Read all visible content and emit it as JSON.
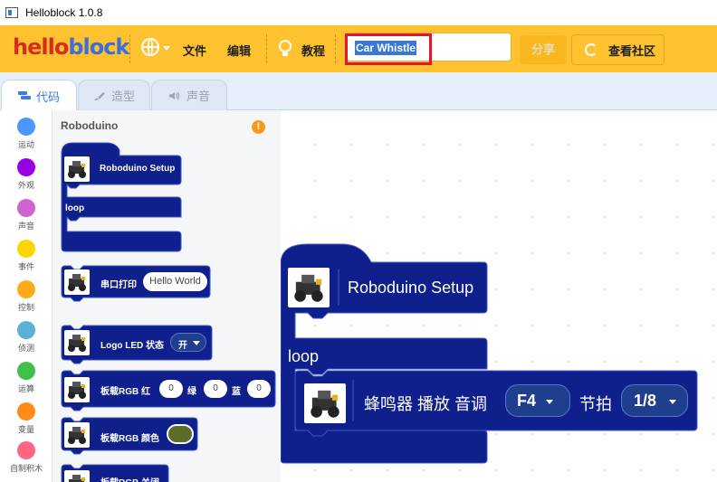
{
  "window": {
    "title": "Helloblock 1.0.8"
  },
  "menubar": {
    "logo_part1": "hello",
    "logo_part2": "block",
    "language_icon": "globe-icon",
    "file_label": "文件",
    "edit_label": "编辑",
    "tutorial_icon": "lightbulb-icon",
    "tutorial_label": "教程",
    "project_title": "Car Whistle",
    "share_label": "分享",
    "community_icon": "refresh-icon",
    "community_label": "查看社区"
  },
  "tabs": [
    {
      "label": "代码",
      "icon": "code-icon",
      "active": true
    },
    {
      "label": "造型",
      "icon": "brush-icon",
      "active": false
    },
    {
      "label": "声音",
      "icon": "speaker-icon",
      "active": false
    }
  ],
  "categories": [
    {
      "label": "运动",
      "color": "#4c97ff"
    },
    {
      "label": "外观",
      "color": "#9a00e6"
    },
    {
      "label": "声音",
      "color": "#cf63cf"
    },
    {
      "label": "事件",
      "color": "#ffd500"
    },
    {
      "label": "控制",
      "color": "#ffab19"
    },
    {
      "label": "侦测",
      "color": "#5cb1d6"
    },
    {
      "label": "运算",
      "color": "#40bf4a"
    },
    {
      "label": "变量",
      "color": "#ff8c1a"
    },
    {
      "label": "自制积木",
      "color": "#ff6680"
    }
  ],
  "flyout": {
    "title": "Roboduino",
    "warning_icon": "info-icon",
    "setup_label": "Roboduino Setup",
    "loop_label": "loop",
    "serial_print_label": "串口打印",
    "serial_print_value": "Hello World",
    "logo_led_label": "Logo LED 状态",
    "logo_led_value": "开",
    "rgb_label": "板载RGB 红",
    "rgb_red": "0",
    "rgb_green_label": "绿",
    "rgb_green": "0",
    "rgb_blue_label": "蓝",
    "rgb_blue": "0",
    "rgb_color_label": "板载RGB 颜色",
    "rgb_color_value": "#5a6b2c",
    "rgb_off_label": "板载RGB 关闭"
  },
  "workspace": {
    "setup_label": "Roboduino Setup",
    "loop_label": "loop",
    "buzzer_label": "蜂鸣器 播放 音调",
    "tone_value": "F4",
    "beat_label": "节拍",
    "beat_value": "1/8"
  },
  "colors": {
    "block": "#0f1f8c",
    "block_border": "#3c58c4",
    "menubar": "#fec12f",
    "highlight": "#e5162a"
  }
}
